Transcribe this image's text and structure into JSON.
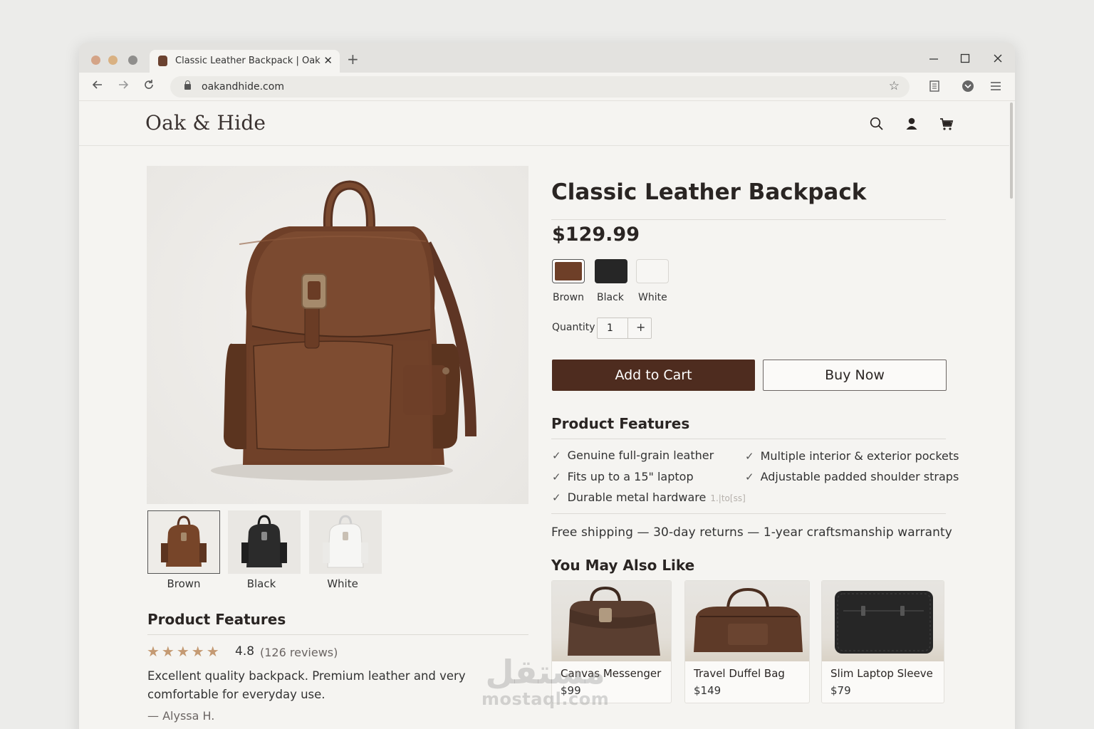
{
  "browser": {
    "tab_title": "Classic Leather Backpack | Oak & Hide",
    "url": "oakandhide.com"
  },
  "site": {
    "logo": "Oak & Hide"
  },
  "product": {
    "title": "Classic Leather Backpack",
    "price": "$129.99",
    "colors": [
      {
        "label": "Brown",
        "hex": "#6e3f28"
      },
      {
        "label": "Black",
        "hex": "#262626"
      },
      {
        "label": "White",
        "hex": "#f7f6f3"
      }
    ],
    "thumbnails": [
      {
        "label": "Brown"
      },
      {
        "label": "Black"
      },
      {
        "label": "White"
      }
    ],
    "quantity_label": "Quantity",
    "quantity": "1",
    "qty_plus": "+",
    "add_to_cart": "Add to Cart",
    "buy_now": "Buy Now"
  },
  "features": {
    "heading": "Product Features",
    "items": [
      "Genuine full-grain leather",
      "Multiple interior & exterior pockets",
      "Fits up to a 15\" laptop",
      "Adjustable padded shoulder straps",
      "Durable metal hardware"
    ],
    "faint_note": "1.|to[ss]"
  },
  "shipping": "Free shipping  —  30-day returns  —  1-year craftsmanship warranty",
  "left_features": {
    "heading": "Product Features",
    "stars": "★★★★★",
    "rating": "4.8",
    "reviews": "(126 reviews)",
    "review_text": "Excellent quality backpack. Premium leather and very comfortable for everyday use.",
    "author": "— Alyssa H."
  },
  "recommendations": {
    "heading": "You May Also Like",
    "items": [
      {
        "name": "Canvas Messenger",
        "price": "$99"
      },
      {
        "name": "Travel Duffel Bag",
        "price": "$149"
      },
      {
        "name": "Slim Laptop Sleeve",
        "price": "$79"
      }
    ]
  },
  "watermark": {
    "arabic": "مستقل",
    "latin": "mostaql.com"
  },
  "colors": {
    "brand_dark": "#4e2c1f",
    "star": "#c49a73",
    "leather": "#7a4a30"
  }
}
